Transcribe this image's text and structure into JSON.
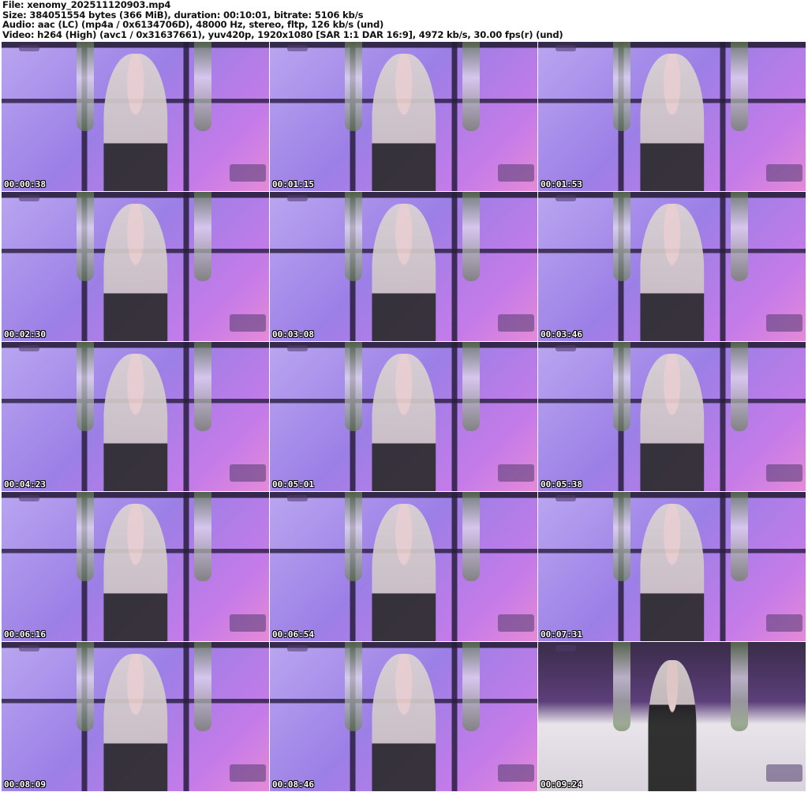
{
  "header": {
    "file": "File: xenomy_202511120903.mp4",
    "size": "Size: 384051554 bytes (366 MiB), duration: 00:10:01, bitrate: 5106 kb/s",
    "audio": "Audio: aac (LC) (mp4a / 0x6134706D), 48000 Hz, stereo, fltp, 126 kb/s (und)",
    "video": "Video: h264 (High) (avc1 / 0x31637661), yuv420p, 1920x1080 [SAR 1:1 DAR 16:9], 4972 kb/s, 30.00 fps(r) (und)"
  },
  "thumbnails": [
    {
      "time": "00:00:38"
    },
    {
      "time": "00:01:15"
    },
    {
      "time": "00:01:53"
    },
    {
      "time": "00:02:30"
    },
    {
      "time": "00:03:08"
    },
    {
      "time": "00:03:46"
    },
    {
      "time": "00:04:23"
    },
    {
      "time": "00:05:01"
    },
    {
      "time": "00:05:38"
    },
    {
      "time": "00:06:16"
    },
    {
      "time": "00:06:54"
    },
    {
      "time": "00:07:31"
    },
    {
      "time": "00:08:09"
    },
    {
      "time": "00:08:46"
    },
    {
      "time": "00:09:24"
    }
  ]
}
